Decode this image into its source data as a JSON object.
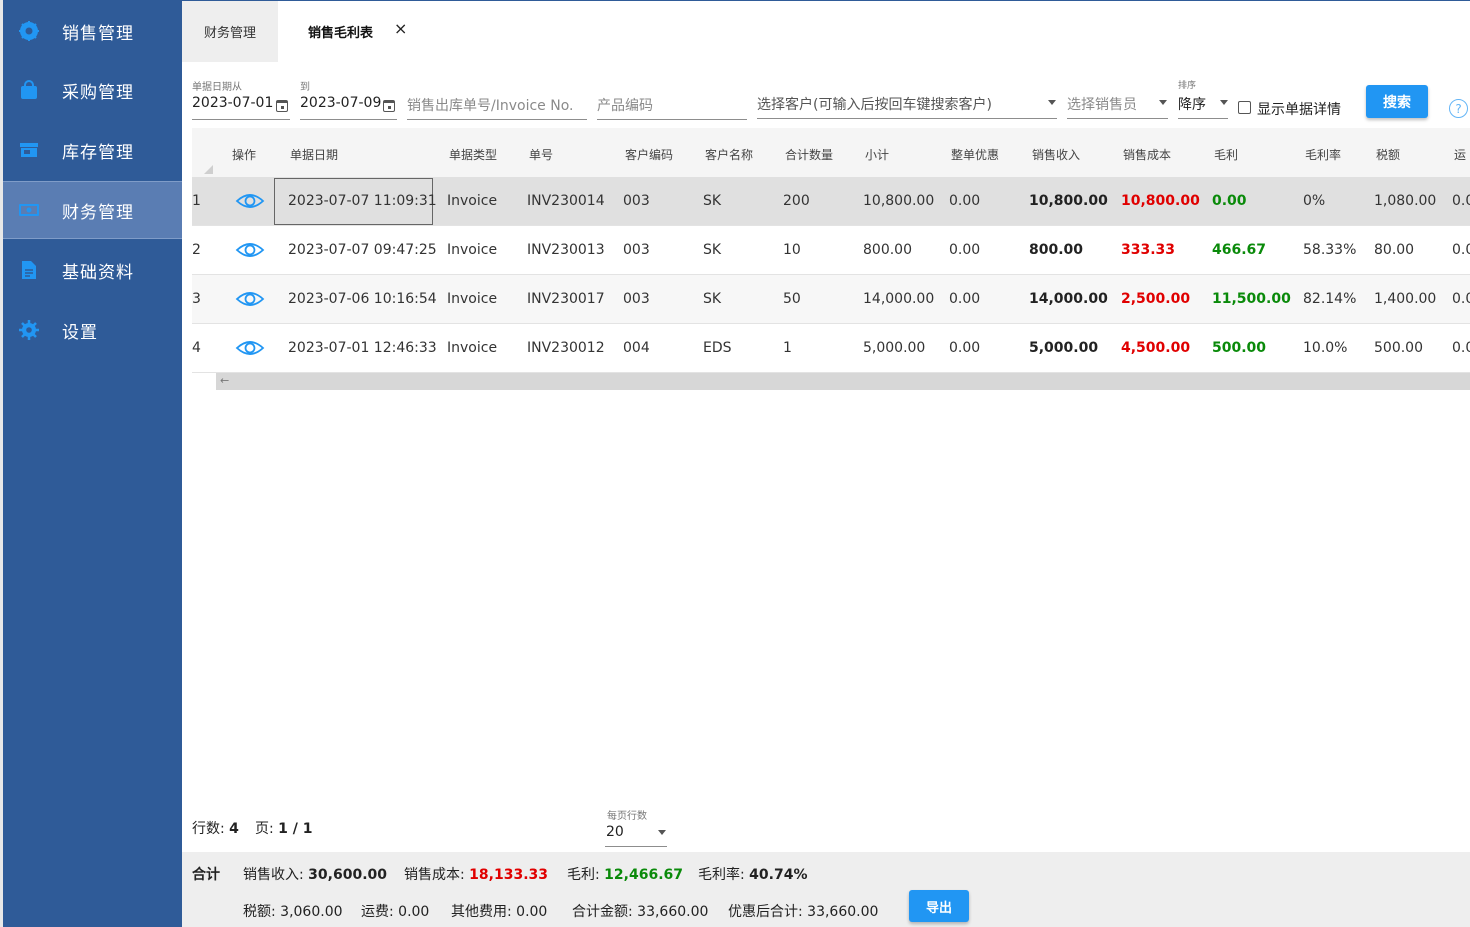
{
  "sidebar": {
    "items": [
      {
        "label": "销售管理",
        "icon": "gear-badge-icon"
      },
      {
        "label": "采购管理",
        "icon": "shopping-bag-icon"
      },
      {
        "label": "库存管理",
        "icon": "store-icon"
      },
      {
        "label": "财务管理",
        "icon": "money-icon",
        "active": true
      },
      {
        "label": "基础资料",
        "icon": "document-icon"
      },
      {
        "label": "设置",
        "icon": "settings-icon"
      }
    ]
  },
  "tabs": {
    "first": "财务管理",
    "second": "销售毛利表",
    "close": "×"
  },
  "filters": {
    "date_from_caption": "单据日期从",
    "date_from": "2023-07-01",
    "date_to_caption": "到",
    "date_to": "2023-07-09",
    "invoice_placeholder": "销售出库单号/Invoice No.",
    "product_placeholder": "产品编码",
    "customer_placeholder": "选择客户(可输入后按回车键搜索客户)",
    "salesperson_placeholder": "选择销售员",
    "sort_caption": "排序",
    "sort_value": "降序",
    "show_details_label": "显示单据详情",
    "search_button": "搜索",
    "help": "?"
  },
  "table": {
    "headers": [
      "操作",
      "单据日期",
      "单据类型",
      "单号",
      "客户编码",
      "客户名称",
      "合计数量",
      "小计",
      "整单优惠",
      "销售收入",
      "销售成本",
      "毛利",
      "毛利率",
      "税额",
      "运"
    ],
    "rows": [
      {
        "index": "1",
        "date": "2023-07-07 11:09:31",
        "type": "Invoice",
        "no": "INV230014",
        "cust_code": "003",
        "cust_name": "SK",
        "qty": "200",
        "subtotal": "10,800.00",
        "discount": "0.00",
        "revenue": "10,800.00",
        "cost": "10,800.00",
        "profit": "0.00",
        "margin": "0%",
        "tax": "1,080.00",
        "freight": "0.0"
      },
      {
        "index": "2",
        "date": "2023-07-07 09:47:25",
        "type": "Invoice",
        "no": "INV230013",
        "cust_code": "003",
        "cust_name": "SK",
        "qty": "10",
        "subtotal": "800.00",
        "discount": "0.00",
        "revenue": "800.00",
        "cost": "333.33",
        "profit": "466.67",
        "margin": "58.33%",
        "tax": "80.00",
        "freight": "0.0"
      },
      {
        "index": "3",
        "date": "2023-07-06 10:16:54",
        "type": "Invoice",
        "no": "INV230017",
        "cust_code": "003",
        "cust_name": "SK",
        "qty": "50",
        "subtotal": "14,000.00",
        "discount": "0.00",
        "revenue": "14,000.00",
        "cost": "2,500.00",
        "profit": "11,500.00",
        "margin": "82.14%",
        "tax": "1,400.00",
        "freight": "0.0"
      },
      {
        "index": "4",
        "date": "2023-07-01 12:46:33",
        "type": "Invoice",
        "no": "INV230012",
        "cust_code": "004",
        "cust_name": "EDS",
        "qty": "1",
        "subtotal": "5,000.00",
        "discount": "0.00",
        "revenue": "5,000.00",
        "cost": "4,500.00",
        "profit": "500.00",
        "margin": "10.0%",
        "tax": "500.00",
        "freight": "0.0"
      }
    ],
    "scroll_arrow": "←"
  },
  "pager": {
    "rows_label": "行数:",
    "rows_value": "4",
    "page_label": "页:",
    "page_value": "1 / 1",
    "per_page_caption": "每页行数",
    "per_page_value": "20"
  },
  "summary": {
    "title": "合计",
    "revenue_label": "销售收入:",
    "revenue": "30,600.00",
    "cost_label": "销售成本:",
    "cost": "18,133.33",
    "profit_label": "毛利:",
    "profit": "12,466.67",
    "margin_label": "毛利率:",
    "margin": "40.74%",
    "tax_label": "税额:",
    "tax": "3,060.00",
    "freight_label": "运费:",
    "freight": "0.00",
    "other_label": "其他费用:",
    "other": "0.00",
    "total_label": "合计金额:",
    "total": "33,660.00",
    "after_discount_label": "优惠后合计:",
    "after_discount": "33,660.00",
    "export_button": "导出"
  },
  "colors": {
    "sidebar": "#2f5b98",
    "sidebar_active": "#5a7db3",
    "primary": "#2196f3",
    "red": "#e00000",
    "green": "#0a8a0a"
  }
}
